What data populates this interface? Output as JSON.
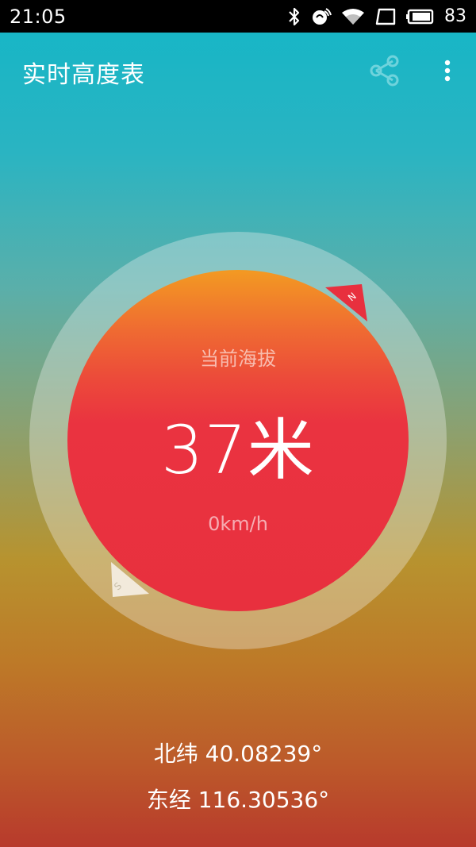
{
  "status_bar": {
    "time": "21:05",
    "battery": "83",
    "icons": [
      "bluetooth-icon",
      "nfc-icon",
      "wifi-icon",
      "screen-rotate-icon",
      "battery-icon"
    ]
  },
  "app_bar": {
    "title": "实时高度表",
    "share_icon": "share-icon",
    "more_icon": "more-vert-icon"
  },
  "altimeter": {
    "label": "当前海拔",
    "value": "37米",
    "speed": "0km/h",
    "compass_north": "N",
    "compass_south": "S"
  },
  "location": {
    "latitude": "北纬 40.08239°",
    "longitude": "东经 116.30536°"
  },
  "colors": {
    "accent_teal": "#13b6c7",
    "dial_red": "#e8303e",
    "north_marker": "#e8303e",
    "south_marker": "#f2eadb"
  }
}
